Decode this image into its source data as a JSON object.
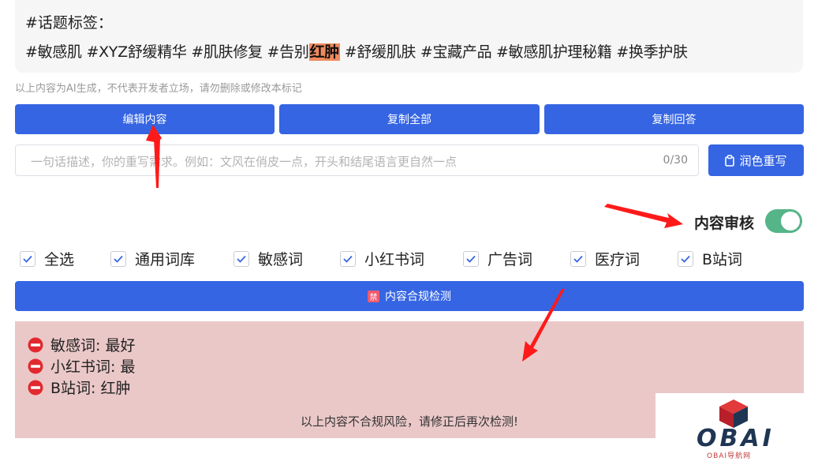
{
  "tags": {
    "heading": "#话题标签：",
    "before_highlight": "#敏感肌 #XYZ舒缓精华 #肌肤修复 #告别",
    "highlight": "红肿",
    "after_highlight": " #舒缓肌肤 #宝藏产品 #敏感肌护理秘籍 #换季护肤"
  },
  "disclaimer": "以上内容为AI生成，不代表开发者立场，请勿删除或修改本标记",
  "actions": {
    "edit": "编辑内容",
    "copy_all": "复制全部",
    "copy_answer": "复制回答"
  },
  "rewrite": {
    "placeholder": "一句话描述，你的重写需求。例如：文风在俏皮一点，开头和结尾语言更自然一点",
    "counter": "0/30",
    "button": "润色重写"
  },
  "review": {
    "label": "内容审核",
    "enabled": true
  },
  "checkboxes": [
    {
      "label": "全选",
      "checked": true
    },
    {
      "label": "通用词库",
      "checked": true
    },
    {
      "label": "敏感词",
      "checked": true
    },
    {
      "label": "小红书词",
      "checked": true
    },
    {
      "label": "广告词",
      "checked": true
    },
    {
      "label": "医疗词",
      "checked": true
    },
    {
      "label": "B站词",
      "checked": true
    }
  ],
  "check_button": {
    "badge": "禁",
    "label": "内容合规检测"
  },
  "results": {
    "items": [
      "敏感词: 最好",
      "小红书词: 最",
      "B站词: 红肿"
    ],
    "message": "以上内容不合规风险，请修正后再次检测!"
  },
  "watermark": {
    "logo": "OBAI",
    "tagline": "OBAI导航网"
  },
  "colors": {
    "primary": "#3565e3",
    "toggle_on": "#55b588",
    "highlight": "#f08a5d",
    "result_bg": "#ebc8c8",
    "error_icon": "#e12a2f",
    "arrow": "#ff1a1a"
  }
}
